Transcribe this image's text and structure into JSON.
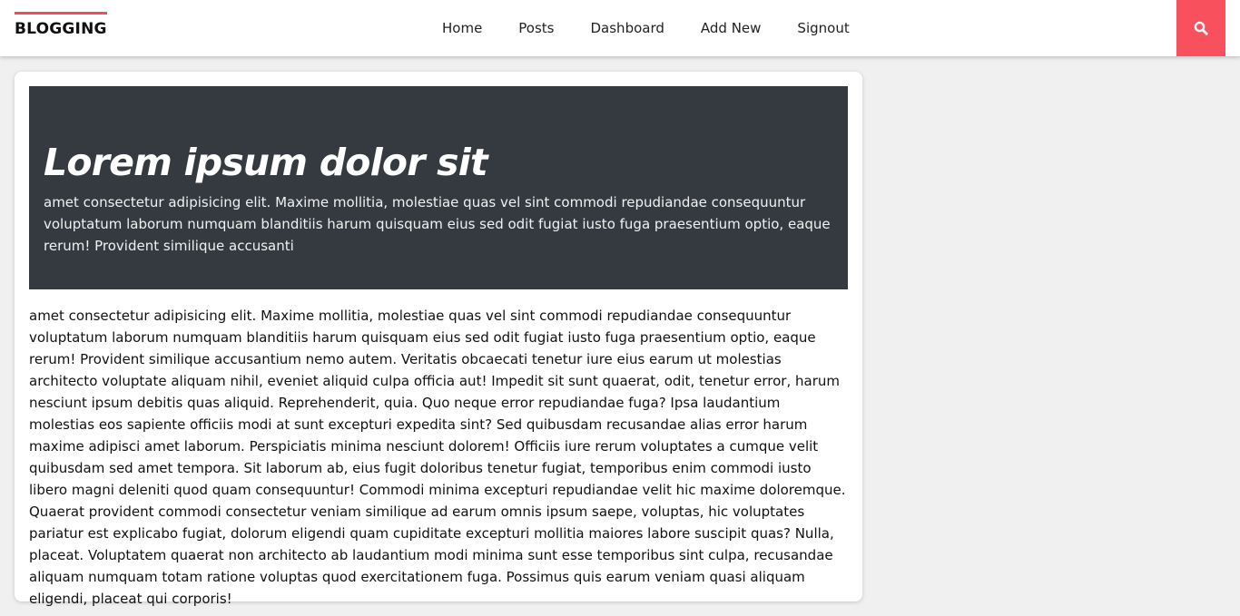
{
  "brand": "BLOGGING",
  "nav": {
    "items": [
      "Home",
      "Posts",
      "Dashboard",
      "Add New",
      "Signout"
    ]
  },
  "search": {
    "icon": "search-icon",
    "bg_color": "#f9505e"
  },
  "colors": {
    "accent": "#f44b5b",
    "hero_bg": "#343a40",
    "page_bg": "#f0f0f0"
  },
  "post": {
    "title": "Lorem ipsum dolor sit",
    "subtitle": "amet consectetur adipisicing elit. Maxime mollitia, molestiae quas vel sint commodi repudiandae consequuntur voluptatum laborum numquam blanditiis harum quisquam eius sed odit fugiat iusto fuga praesentium optio, eaque rerum! Provident similique accusanti",
    "body": "amet consectetur adipisicing elit. Maxime mollitia, molestiae quas vel sint commodi repudiandae consequuntur voluptatum laborum numquam blanditiis harum quisquam eius sed odit fugiat iusto fuga praesentium optio, eaque rerum! Provident similique accusantium nemo autem. Veritatis obcaecati tenetur iure eius earum ut molestias architecto voluptate aliquam nihil, eveniet aliquid culpa officia aut! Impedit sit sunt quaerat, odit, tenetur error, harum nesciunt ipsum debitis quas aliquid. Reprehenderit, quia. Quo neque error repudiandae fuga? Ipsa laudantium molestias eos sapiente officiis modi at sunt excepturi expedita sint? Sed quibusdam recusandae alias error harum maxime adipisci amet laborum. Perspiciatis minima nesciunt dolorem! Officiis iure rerum voluptates a cumque velit quibusdam sed amet tempora. Sit laborum ab, eius fugit doloribus tenetur fugiat, temporibus enim commodi iusto libero magni deleniti quod quam consequuntur! Commodi minima excepturi repudiandae velit hic maxime doloremque. Quaerat provident commodi consectetur veniam similique ad earum omnis ipsum saepe, voluptas, hic voluptates pariatur est explicabo fugiat, dolorum eligendi quam cupiditate excepturi mollitia maiores labore suscipit quas? Nulla, placeat. Voluptatem quaerat non architecto ab laudantium modi minima sunt esse temporibus sint culpa, recusandae aliquam numquam totam ratione voluptas quod exercitationem fuga. Possimus quis earum veniam quasi aliquam eligendi, placeat qui corporis!"
  }
}
